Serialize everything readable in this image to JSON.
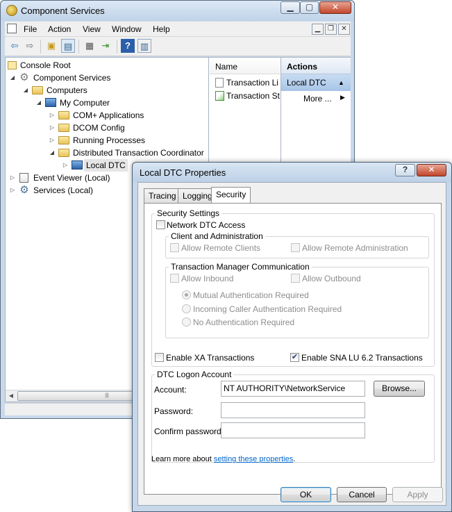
{
  "main_window": {
    "title": "Component Services",
    "menu": [
      "File",
      "Action",
      "View",
      "Window",
      "Help"
    ],
    "tree": {
      "root": "Console Root",
      "component_services": "Component Services",
      "computers": "Computers",
      "my_computer": "My Computer",
      "com_plus": "COM+ Applications",
      "dcom_config": "DCOM Config",
      "running_processes": "Running Processes",
      "dtc": "Distributed Transaction Coordinator",
      "local_dtc": "Local DTC",
      "event_viewer": "Event Viewer (Local)",
      "services": "Services (Local)"
    },
    "list": {
      "header": "Name",
      "items": [
        "Transaction Li",
        "Transaction St"
      ]
    },
    "actions": {
      "header": "Actions",
      "selected": "Local DTC",
      "more": "More ..."
    }
  },
  "dialog": {
    "title": "Local DTC Properties",
    "tabs": [
      "Tracing",
      "Logging",
      "Security"
    ],
    "active_tab": "Security",
    "security_settings": {
      "group_label": "Security Settings",
      "network_dtc_access": {
        "label": "Network DTC Access",
        "checked": false
      },
      "client_admin": {
        "group_label": "Client and Administration",
        "allow_remote_clients": {
          "label": "Allow Remote Clients",
          "checked": false
        },
        "allow_remote_admin": {
          "label": "Allow Remote Administration",
          "checked": false
        }
      },
      "tm_comm": {
        "group_label": "Transaction Manager Communication",
        "allow_inbound": {
          "label": "Allow Inbound",
          "checked": false
        },
        "allow_outbound": {
          "label": "Allow Outbound",
          "checked": false
        },
        "radios": [
          {
            "label": "Mutual Authentication Required",
            "selected": true
          },
          {
            "label": "Incoming Caller Authentication Required",
            "selected": false
          },
          {
            "label": "No Authentication Required",
            "selected": false
          }
        ]
      },
      "enable_xa": {
        "label": "Enable XA Transactions",
        "checked": false
      },
      "enable_sna": {
        "label": "Enable SNA LU 6.2 Transactions",
        "checked": true
      }
    },
    "logon": {
      "group_label": "DTC Logon Account",
      "account_label": "Account:",
      "account_value": "NT AUTHORITY\\NetworkService",
      "browse_label": "Browse...",
      "password_label": "Password:",
      "password_value": "",
      "confirm_label": "Confirm password:",
      "confirm_value": ""
    },
    "learn_more_prefix": "Learn more about ",
    "learn_more_link": "setting these properties",
    "learn_more_suffix": ".",
    "ok_label": "OK",
    "cancel_label": "Cancel",
    "apply_label": "Apply"
  }
}
